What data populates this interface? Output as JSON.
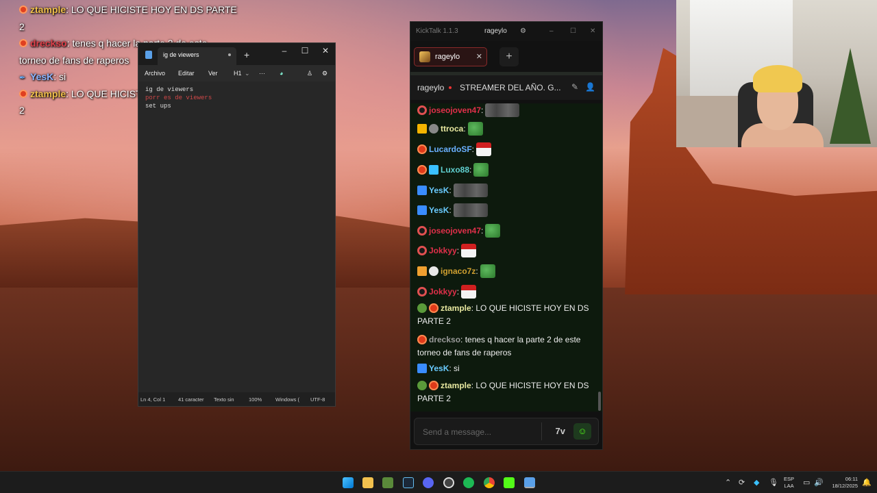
{
  "overlay_chat": [
    {
      "user": "ztample",
      "text": ": LO QUE HICISTE HOY EN DS PARTE",
      "cont": "2",
      "color": "#f1c04a",
      "badge": "og"
    },
    {
      "user": "dreckso",
      "text": ": tenes q hacer la parte 2 de este",
      "cont": "torneo de fans de raperos",
      "color": "#e0404a",
      "badge": "og"
    },
    {
      "user": "YesK",
      "text": ": si",
      "cont": "",
      "color": "#8ab4ff",
      "badge": "mod"
    },
    {
      "user": "ztample",
      "text": ": LO QUE HICISTE HOY EN DS PARTE",
      "cont": "2",
      "color": "#f1c04a",
      "badge": "og"
    }
  ],
  "notepad": {
    "tab_title": "ig de viewers",
    "menu": {
      "file": "Archivo",
      "edit": "Editar",
      "view": "Ver",
      "heading": "H1"
    },
    "lines": [
      "ig de viewers",
      "porr es de viewers",
      "set ups"
    ],
    "status": {
      "position": "Ln 4, Col 1",
      "chars": "41 caracter",
      "format": "Texto sin",
      "zoom": "100%",
      "eol": "Windows (",
      "encoding": "UTF-8"
    }
  },
  "kicktalk": {
    "app_title": "KickTalk 1.1.3",
    "user": "rageylo",
    "tab_label": "rageylo",
    "channel": "rageylo",
    "stream_title": "STREAMER DEL AÑO. G...",
    "input_placeholder": "Send a message...",
    "emote_btn": "7tv",
    "messages": [
      {
        "user": "joseojoven47",
        "color": "#e0304a",
        "text": ":",
        "badges": [
          "sub"
        ],
        "emote": "grp"
      },
      {
        "user": "ttroca",
        "color": "#e8e8a0",
        "text": ":",
        "badges": [
          "one",
          "gray"
        ],
        "emote": "pepe"
      },
      {
        "user": "LucardoSF",
        "color": "#6ab0ff",
        "text": ":",
        "badges": [
          "og"
        ],
        "emote": "santa"
      },
      {
        "user": "Luxo88",
        "color": "#60d0d0",
        "text": ":",
        "badges": [
          "og",
          "cube"
        ],
        "emote": "pepe"
      },
      {
        "user": "YesK",
        "color": "#6acbff",
        "text": ":",
        "badges": [
          "mod"
        ],
        "emote": "grp"
      },
      {
        "user": "YesK",
        "color": "#6acbff",
        "text": ":",
        "badges": [
          "mod"
        ],
        "emote": "grp"
      },
      {
        "user": "joseojoven47",
        "color": "#e0304a",
        "text": ":",
        "badges": [
          "sub"
        ],
        "emote": "pepe"
      },
      {
        "user": "Jokkyy",
        "color": "#e0304a",
        "text": ":",
        "badges": [
          "sub"
        ],
        "emote": "santa"
      },
      {
        "user": "ignaco7z",
        "color": "#d0a030",
        "text": ":",
        "badges": [
          "7tv",
          "skull"
        ],
        "emote": "pepe"
      },
      {
        "user": "Jokkyy",
        "color": "#e0304a",
        "text": ":",
        "badges": [
          "sub"
        ],
        "emote": "santa"
      },
      {
        "user": "ztample",
        "color": "#e8e8a0",
        "text": ": LO QUE HICISTE HOY EN DS PARTE 2",
        "badges": [
          "bot",
          "og"
        ],
        "emote": ""
      },
      {
        "user": "dreckso",
        "color": "#9a9a9a",
        "text": ": tenes q hacer la parte 2 de este torneo de fans de raperos",
        "badges": [
          "og"
        ],
        "emote": ""
      },
      {
        "user": "YesK",
        "color": "#6acbff",
        "text": ": si",
        "badges": [
          "mod"
        ],
        "emote": ""
      },
      {
        "user": "ztample",
        "color": "#e8e8a0",
        "text": ": LO QUE HICISTE HOY EN DS PARTE 2",
        "badges": [
          "bot",
          "og"
        ],
        "emote": ""
      }
    ]
  },
  "taskbar": {
    "lang1": "ESP",
    "lang2": "LAA",
    "time": "06:11",
    "date": "18/12/2025"
  }
}
